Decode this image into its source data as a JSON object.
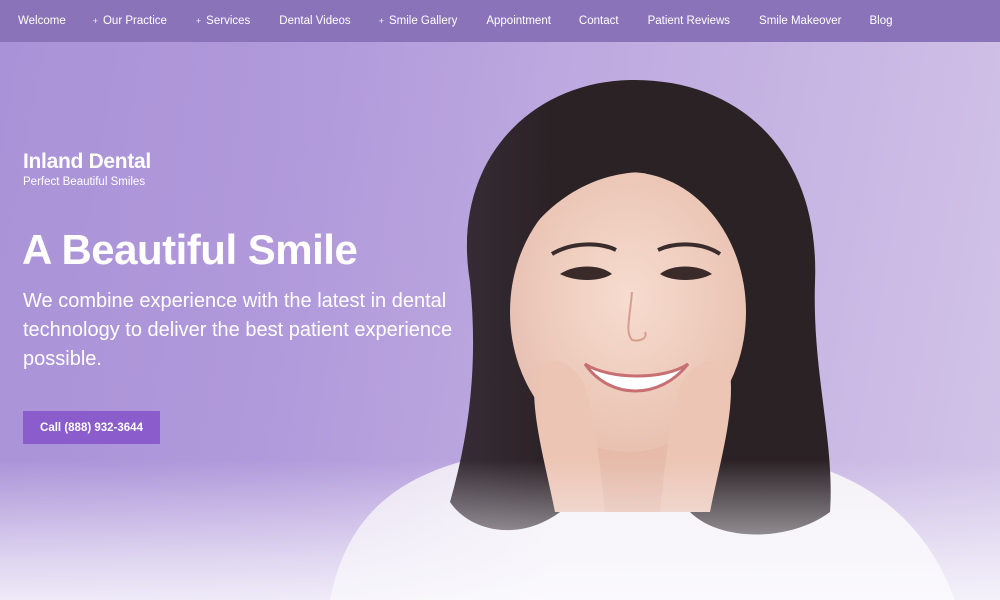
{
  "nav": {
    "items": [
      {
        "label": "Welcome",
        "has_plus": false
      },
      {
        "label": "Our Practice",
        "has_plus": true
      },
      {
        "label": "Services",
        "has_plus": true
      },
      {
        "label": "Dental Videos",
        "has_plus": false
      },
      {
        "label": "Smile Gallery",
        "has_plus": true
      },
      {
        "label": "Appointment",
        "has_plus": false
      },
      {
        "label": "Contact",
        "has_plus": false
      },
      {
        "label": "Patient Reviews",
        "has_plus": false
      },
      {
        "label": "Smile Makeover",
        "has_plus": false
      },
      {
        "label": "Blog",
        "has_plus": false
      }
    ],
    "plus_symbol": "+"
  },
  "brand": {
    "name": "Inland Dental",
    "tagline": "Perfect Beautiful Smiles"
  },
  "hero": {
    "headline": "A Beautiful Smile",
    "subtext": "We combine experience with the latest in dental technology to deliver the best patient experience possible.",
    "cta_label": "Call (888) 932-3644",
    "photo_subject": "smiling-woman-photo"
  },
  "colors": {
    "nav_bg": "#8b73b9",
    "hero_bg": "#b49ddc",
    "cta_bg": "#8a5ccc",
    "text": "#ffffff"
  }
}
